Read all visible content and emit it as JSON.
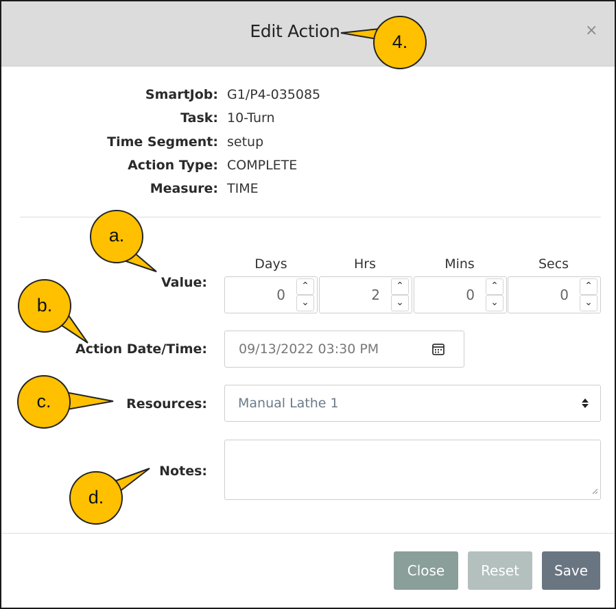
{
  "dialog": {
    "title": "Edit Action",
    "close_glyph": "×"
  },
  "info": [
    {
      "label": "SmartJob:",
      "value": "G1/P4-035085"
    },
    {
      "label": "Task:",
      "value": "10-Turn"
    },
    {
      "label": "Time Segment:",
      "value": "setup"
    },
    {
      "label": "Action Type:",
      "value": "COMPLETE"
    },
    {
      "label": "Measure:",
      "value": "TIME"
    }
  ],
  "form": {
    "value_label": "Value:",
    "duration": {
      "days_header": "Days",
      "days_value": "0",
      "hrs_header": "Hrs",
      "hrs_value": "2",
      "mins_header": "Mins",
      "mins_value": "0",
      "secs_header": "Secs",
      "secs_value": "0"
    },
    "date_label": "Action Date/Time:",
    "date_value": "09/13/2022 03:30 PM",
    "resources_label": "Resources:",
    "resources_value": "Manual Lathe 1",
    "notes_label": "Notes:",
    "notes_value": ""
  },
  "buttons": {
    "close": "Close",
    "reset": "Reset",
    "save": "Save"
  },
  "callouts": {
    "c4": "4.",
    "ca": "a.",
    "cb": "b.",
    "cc": "c.",
    "cd": "d."
  },
  "colors": {
    "callout_fill": "#ffc000",
    "header_bg": "#dcdcdc",
    "save_bg": "#6a7582",
    "close_bg": "#8a9e9a",
    "reset_bg": "#b3c0bd"
  }
}
